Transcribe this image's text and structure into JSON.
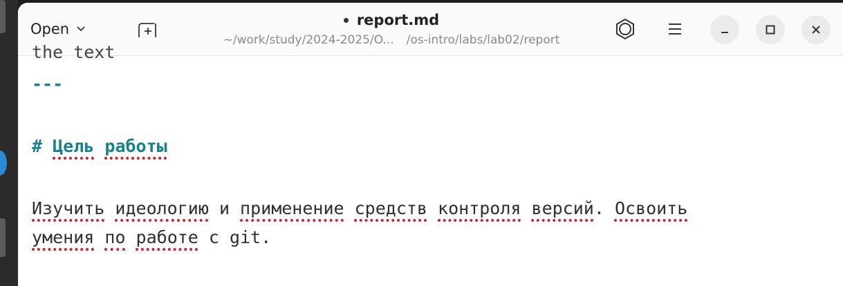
{
  "headerbar": {
    "open_label": "Open",
    "title": "report.md",
    "modified": true,
    "subtitle_left": "~/work/study/2024-2025/O...",
    "subtitle_right": "/os-intro/labs/lab02/report",
    "icons": [
      "chevron-down-icon",
      "new-tab-icon",
      "settings-icon",
      "menu-icon",
      "minimize-icon",
      "maximize-icon",
      "close-icon"
    ]
  },
  "editor": {
    "partial_line": "the text",
    "hr": "---",
    "heading_hash": "#",
    "heading_word1": "Цель",
    "heading_word2": "работы",
    "para_line1": [
      {
        "text": "Изучить",
        "misspelled": true
      },
      {
        "text": " ",
        "misspelled": false
      },
      {
        "text": "идеологию",
        "misspelled": true
      },
      {
        "text": " и ",
        "misspelled": false
      },
      {
        "text": "применение",
        "misspelled": true
      },
      {
        "text": " ",
        "misspelled": false
      },
      {
        "text": "средств",
        "misspelled": true
      },
      {
        "text": " ",
        "misspelled": false
      },
      {
        "text": "контроля",
        "misspelled": true
      },
      {
        "text": " ",
        "misspelled": false
      },
      {
        "text": "версий",
        "misspelled": true
      },
      {
        "text": ". ",
        "misspelled": false
      },
      {
        "text": "Освоить",
        "misspelled": true
      }
    ],
    "para_line2": [
      {
        "text": "умения",
        "misspelled": true
      },
      {
        "text": " ",
        "misspelled": false
      },
      {
        "text": "по",
        "misspelled": true
      },
      {
        "text": " ",
        "misspelled": false
      },
      {
        "text": "работе",
        "misspelled": true
      },
      {
        "text": " с git.",
        "misspelled": false
      }
    ]
  },
  "colors": {
    "accent_teal": "#19818a",
    "spell_red": "#d21d2b"
  }
}
